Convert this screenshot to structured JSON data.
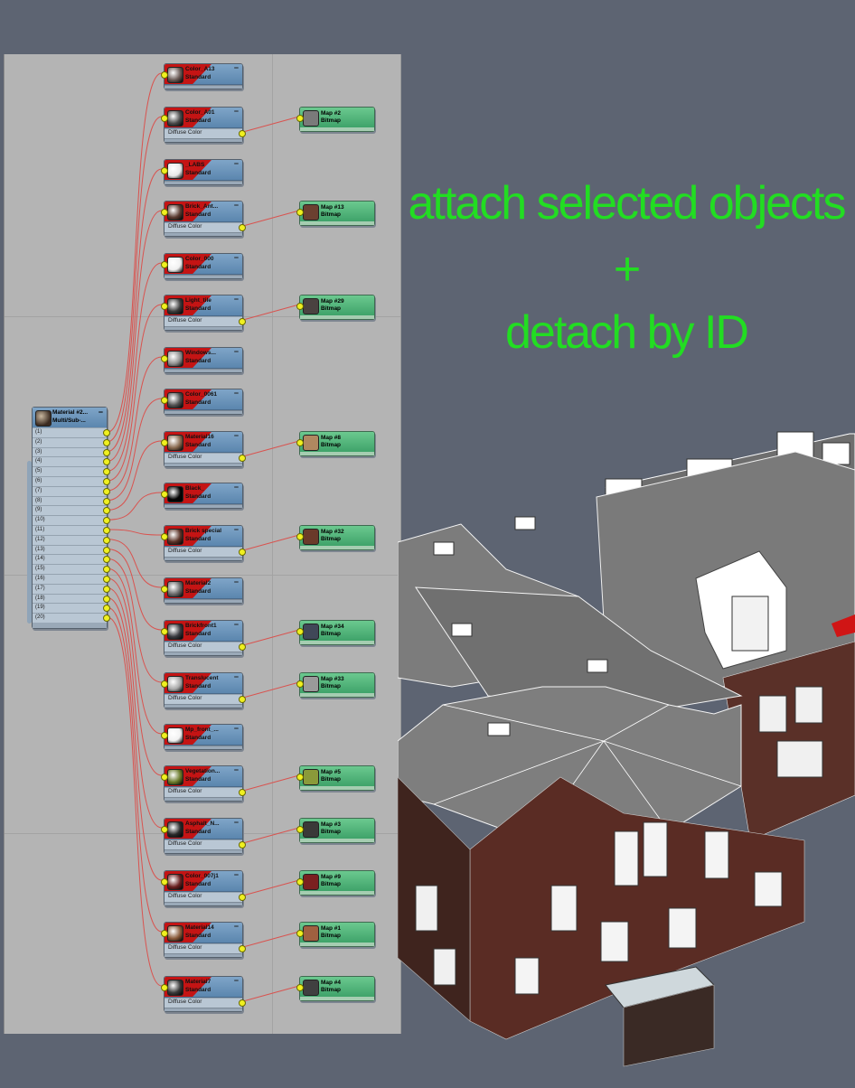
{
  "headline": {
    "line1": "attach selected objects",
    "line2": "+",
    "line3": "detach by ID"
  },
  "multi_material": {
    "name": "Material #2...",
    "type": "Multi/Sub-...",
    "slots": [
      "(1)",
      "(2)",
      "(3)",
      "(4)",
      "(5)",
      "(6)",
      "(7)",
      "(8)",
      "(9)",
      "(10)",
      "(11)",
      "(12)",
      "(13)",
      "(14)",
      "(15)",
      "(16)",
      "(17)",
      "(18)",
      "(19)",
      "(20)"
    ]
  },
  "slot_label": "Diffuse Color",
  "materials": [
    {
      "name": "Color_A13",
      "type": "Standard",
      "swatch": "#6a5a55",
      "diffuse": false
    },
    {
      "name": "Color_A01",
      "type": "Standard",
      "swatch": "#4a4a4a",
      "diffuse": true,
      "map": {
        "name": "Map #2",
        "type": "Bitmap",
        "swatch": "#7a7a7a"
      }
    },
    {
      "name": "_LABS",
      "type": "Standard",
      "swatch": "#e8e8e8",
      "diffuse": false
    },
    {
      "name": "Brick_Ant...",
      "type": "Standard",
      "swatch": "#5a3a30",
      "diffuse": true,
      "map": {
        "name": "Map #13",
        "type": "Bitmap",
        "swatch": "#6b4030"
      }
    },
    {
      "name": "Color_000",
      "type": "Standard",
      "swatch": "#f0f0f0",
      "diffuse": false
    },
    {
      "name": "Light_tile",
      "type": "Standard",
      "swatch": "#3c3c3c",
      "diffuse": true,
      "map": {
        "name": "Map #29",
        "type": "Bitmap",
        "swatch": "#4a4240"
      }
    },
    {
      "name": "Windows...",
      "type": "Standard",
      "swatch": "#909090",
      "diffuse": false
    },
    {
      "name": "Color_0061",
      "type": "Standard",
      "swatch": "#505050",
      "diffuse": false
    },
    {
      "name": "Material16",
      "type": "Standard",
      "swatch": "#8a6a50",
      "diffuse": true,
      "map": {
        "name": "Map #8",
        "type": "Bitmap",
        "swatch": "#b08860"
      }
    },
    {
      "name": "Black_",
      "type": "Standard",
      "swatch": "#050505",
      "diffuse": false
    },
    {
      "name": "Brick special",
      "type": "Standard",
      "swatch": "#5c3328",
      "diffuse": true,
      "map": {
        "name": "Map #32",
        "type": "Bitmap",
        "swatch": "#6a3a2a"
      }
    },
    {
      "name": "Material2",
      "type": "Standard",
      "swatch": "#6a6a6a",
      "diffuse": false
    },
    {
      "name": "Brickfront1",
      "type": "Standard",
      "swatch": "#3a3a40",
      "diffuse": true,
      "map": {
        "name": "Map #34",
        "type": "Bitmap",
        "swatch": "#404858"
      }
    },
    {
      "name": "Translucent",
      "type": "Standard",
      "swatch": "#a8a8a8",
      "diffuse": true,
      "map": {
        "name": "Map #33",
        "type": "Bitmap",
        "swatch": "#9a9a9a"
      }
    },
    {
      "name": "Mp_front_...",
      "type": "Standard",
      "swatch": "#f2f2f2",
      "diffuse": false
    },
    {
      "name": "Vegetation...",
      "type": "Standard",
      "swatch": "#6a7a2a",
      "diffuse": true,
      "map": {
        "name": "Map #5",
        "type": "Bitmap",
        "swatch": "#8a9a3a"
      }
    },
    {
      "name": "Asphalt_N...",
      "type": "Standard",
      "swatch": "#2a2a2a",
      "diffuse": true,
      "map": {
        "name": "Map #3",
        "type": "Bitmap",
        "swatch": "#3a3a38"
      }
    },
    {
      "name": "Color_007j1",
      "type": "Standard",
      "swatch": "#6a2020",
      "diffuse": true,
      "map": {
        "name": "Map #9",
        "type": "Bitmap",
        "swatch": "#7a2020"
      }
    },
    {
      "name": "Material14",
      "type": "Standard",
      "swatch": "#8a5a3a",
      "diffuse": true,
      "map": {
        "name": "Map #1",
        "type": "Bitmap",
        "swatch": "#a06040"
      }
    },
    {
      "name": "Material7",
      "type": "Standard",
      "swatch": "#3a3a3a",
      "diffuse": true,
      "map": {
        "name": "Map #4",
        "type": "Bitmap",
        "swatch": "#404040"
      }
    }
  ],
  "colors": {
    "background": "#5d6472",
    "headline": "#22dd22",
    "wire": "#d9534f",
    "material_node": "#5b86ae",
    "bitmap_node": "#3fa36a",
    "port": "#f0f020"
  }
}
